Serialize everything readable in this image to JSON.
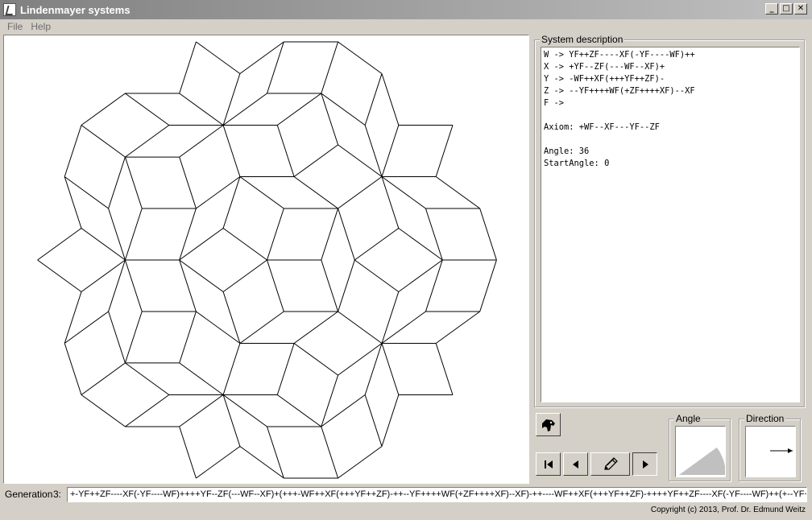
{
  "window": {
    "title": "Lindenmayer systems",
    "controls": {
      "minimize": "_",
      "maximize": "□",
      "close": "✕"
    }
  },
  "menu": {
    "items": [
      "File",
      "Help"
    ]
  },
  "description": {
    "label": "System description",
    "text": "W -> YF++ZF----XF(-YF----WF)++\nX -> +YF--ZF(---WF--XF)+\nY -> -WF++XF(+++YF++ZF)-\nZ -> --YF++++WF(+ZF++++XF)--XF\nF ->\n\nAxiom: +WF--XF---YF--ZF\n\nAngle: 36\nStartAngle: 0"
  },
  "toolbar": {
    "icons": [
      "turtle-icon",
      "skip-start-icon",
      "step-back-icon",
      "pencil-icon",
      "step-forward-icon"
    ]
  },
  "angle_panel": {
    "label": "Angle",
    "angle_degrees": 36
  },
  "direction_panel": {
    "label": "Direction",
    "start_angle_degrees": 0
  },
  "generation": {
    "label": "Generation",
    "number": "3:",
    "value": "+-YF++ZF----XF(-YF----WF)++++YF--ZF(---WF--XF)+(+++-WF++XF(+++YF++ZF)-++--YF++++WF(+ZF++++XF)--XF)-++----WF++XF(+++YF++ZF)-++++YF++ZF----XF(-YF----WF)++(+--YF++++WF(+ZF+"
  },
  "footer": {
    "copyright": "Copyright (c) 2013, Prof. Dr. Edmund Weitz"
  },
  "colors": {
    "chrome": "#d4d0c8",
    "title_gradient_start": "#808080",
    "drawing_stroke": "#000000",
    "angle_fill": "#c0c0c0"
  }
}
